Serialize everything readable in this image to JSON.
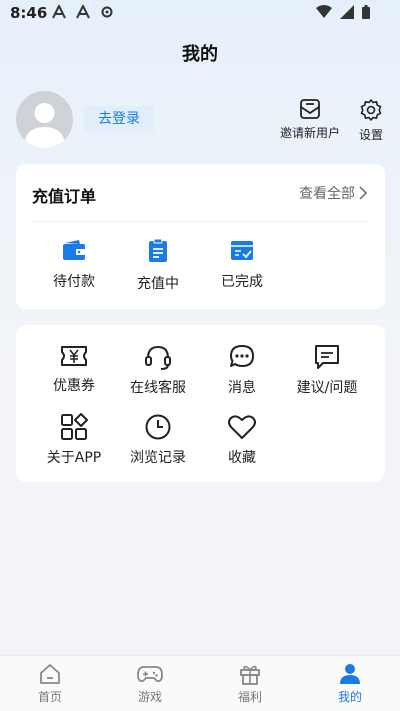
{
  "status_bar": {
    "time": "8:46"
  },
  "header": {
    "title": "我的"
  },
  "profile": {
    "login_label": "去登录",
    "invite_label": "邀请新用户",
    "settings_label": "设置"
  },
  "orders": {
    "title": "充值订单",
    "view_all": "查看全部",
    "items": [
      {
        "label": "待付款",
        "icon": "wallet-icon"
      },
      {
        "label": "充值中",
        "icon": "clipboard-icon"
      },
      {
        "label": "已完成",
        "icon": "completed-check-icon"
      }
    ]
  },
  "services": {
    "items": [
      {
        "label": "优惠券",
        "icon": "coupon-icon"
      },
      {
        "label": "在线客服",
        "icon": "headset-icon"
      },
      {
        "label": "消息",
        "icon": "chat-bubble-icon"
      },
      {
        "label": "建议/问题",
        "icon": "feedback-icon"
      },
      {
        "label": "关于APP",
        "icon": "apps-grid-icon"
      },
      {
        "label": "浏览记录",
        "icon": "clock-icon"
      },
      {
        "label": "收藏",
        "icon": "heart-icon"
      }
    ]
  },
  "tab_bar": {
    "items": [
      {
        "label": "首页",
        "icon": "home-icon"
      },
      {
        "label": "游戏",
        "icon": "gamepad-icon"
      },
      {
        "label": "福利",
        "icon": "gift-icon"
      },
      {
        "label": "我的",
        "icon": "person-icon"
      }
    ],
    "active_index": 3
  },
  "colors": {
    "accent": "#1a7be6",
    "background": "#f3f4f7",
    "card": "#ffffff"
  }
}
